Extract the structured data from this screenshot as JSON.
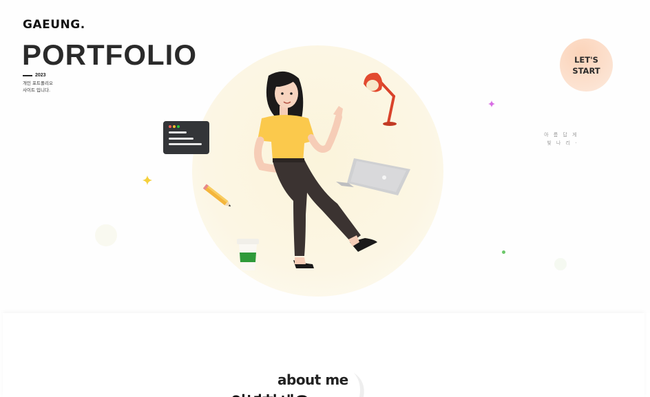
{
  "brand": {
    "logo_text": "GAEUNG."
  },
  "hero": {
    "title": "PORTFOLIO",
    "year": "2023",
    "description_line1": "개인 포트폴리오",
    "description_line2": "사이트 입니다."
  },
  "cta": {
    "line1": "LET'S",
    "line2": "START"
  },
  "side_text": {
    "line1": "아 름 답 게",
    "line2": "빛 나 리 ·"
  },
  "about": {
    "label": "about me",
    "heading": "안녕하세요"
  },
  "colors": {
    "sun": "#fcf6e4",
    "cta_bg": "#fce3d2",
    "shirt": "#fbc94c",
    "pants": "#3b3331",
    "lamp": "#d9432b",
    "cup_band": "#2e9a3a"
  },
  "icons": [
    "code-window-icon",
    "pencil-icon",
    "coffee-cup-icon",
    "desk-lamp-icon",
    "laptop-icon",
    "sparkle-icon"
  ]
}
